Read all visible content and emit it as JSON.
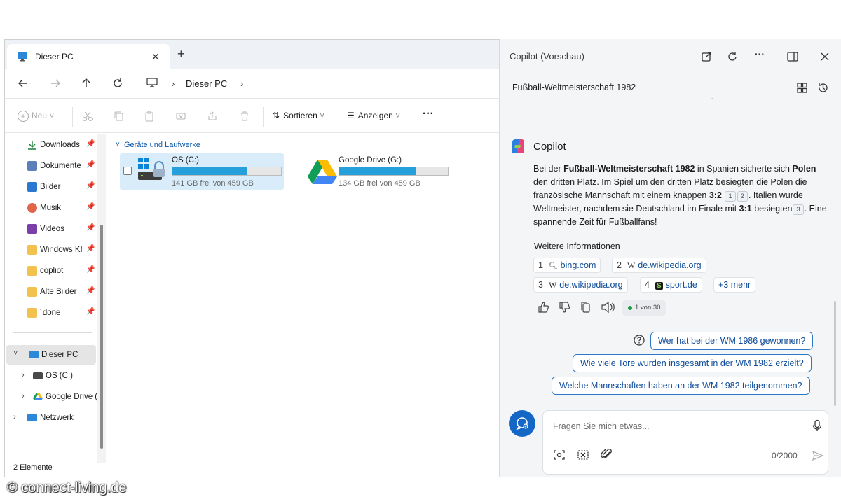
{
  "explorer": {
    "tab_title": "Dieser PC",
    "tab_close": "✕",
    "new_tab": "+",
    "breadcrumb": "Dieser PC",
    "ribbon": {
      "new_label": "Neu",
      "sort_label": "Sortieren",
      "view_label": "Anzeigen",
      "more_label": "···"
    },
    "nav_items": [
      {
        "label": "Downloads",
        "icon": "download-icon",
        "pinned": true
      },
      {
        "label": "Dokumente",
        "icon": "documents-icon",
        "pinned": true
      },
      {
        "label": "Bilder",
        "icon": "pictures-icon",
        "pinned": true
      },
      {
        "label": "Musik",
        "icon": "music-icon",
        "pinned": true
      },
      {
        "label": "Videos",
        "icon": "videos-icon",
        "pinned": true
      },
      {
        "label": "Windows KI",
        "icon": "folder-icon",
        "pinned": true
      },
      {
        "label": "copliot",
        "icon": "folder-icon",
        "pinned": true
      },
      {
        "label": "Alte Bilder",
        "icon": "folder-icon",
        "pinned": true
      },
      {
        "label": "´done",
        "icon": "folder-icon",
        "pinned": true
      }
    ],
    "tree_items": [
      {
        "label": "Dieser PC",
        "icon": "pc-icon",
        "expanded": true
      },
      {
        "label": "OS (C:)",
        "icon": "drive-icon"
      },
      {
        "label": "Google Drive (",
        "icon": "google-drive-icon"
      },
      {
        "label": "Netzwerk",
        "icon": "network-icon"
      }
    ],
    "group_header": "Geräte und Laufwerke",
    "drives": [
      {
        "name": "OS (C:)",
        "free": "141 GB frei von 459 GB",
        "used_fraction": 0.69
      },
      {
        "name": "Google Drive (G:)",
        "free": "134 GB frei von 459 GB",
        "used_fraction": 0.71
      }
    ],
    "status": "2 Elemente"
  },
  "copilot": {
    "title": "Copilot (Vorschau)",
    "topic": "Fußball-Weltmeisterschaft 1982",
    "topic_mark": "-",
    "bot_name": "Copilot",
    "answer": {
      "p1": "Bei der ",
      "b1": "Fußball-Weltmeisterschaft 1982",
      "p2": " in Spanien sicherte sich ",
      "b2": "Polen",
      "p3": " den dritten Platz. Im Spiel um den dritten Platz besiegten die Polen die französische Mannschaft mit einem knappen ",
      "b3": "3:2",
      "c1": "1",
      "c2": "2",
      "p4": ". Italien wurde Weltmeister, nachdem sie Deutschland im Finale mit ",
      "b4": "3:1",
      "p5": " besiegten",
      "c3": "3",
      "p6": ". Eine spannende Zeit für Fußballfans!"
    },
    "more_info": "Weitere Informationen",
    "sources": [
      {
        "num": "1",
        "label": "bing.com",
        "icon": "search"
      },
      {
        "num": "2",
        "label": "de.wikipedia.org",
        "icon": "W"
      },
      {
        "num": "3",
        "label": "de.wikipedia.org",
        "icon": "W"
      },
      {
        "num": "4",
        "label": "sport.de",
        "icon": "S"
      }
    ],
    "more_sources": "+3 mehr",
    "turn_count": "1 von 30",
    "suggestions": [
      "Wer hat bei der WM 1986 gewonnen?",
      "Wie viele Tore wurden insgesamt in der WM 1982 erzielt?",
      "Welche Mannschaften haben an der WM 1982 teilgenommen?"
    ],
    "input_placeholder": "Fragen Sie mich etwas...",
    "char_counter": "0/2000"
  },
  "watermark": "© connect-living.de",
  "colors": {
    "accent": "#1467c4",
    "progress": "#26a0da",
    "link": "#0f4c99",
    "selection": "#d8ecf9"
  }
}
